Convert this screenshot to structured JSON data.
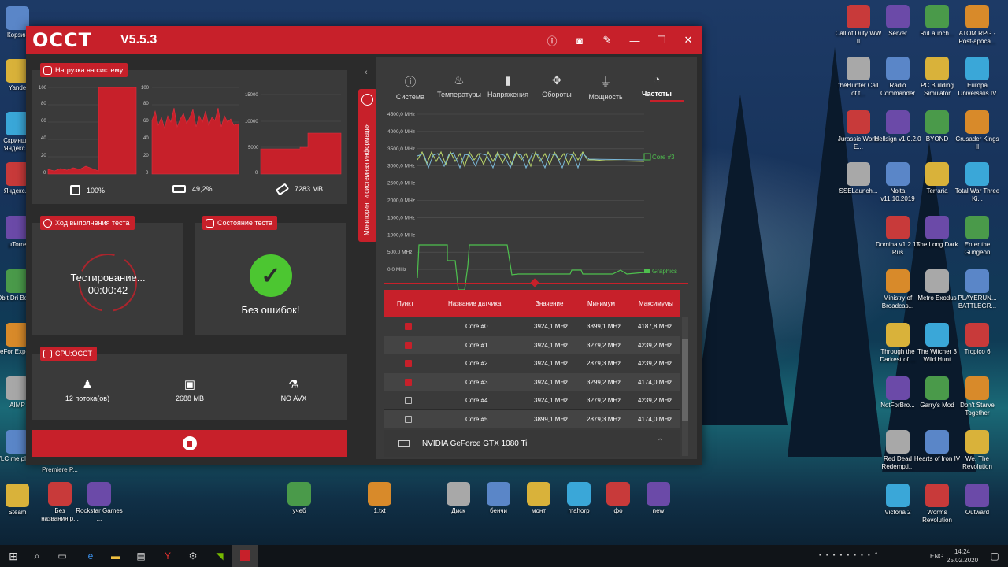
{
  "window": {
    "logo": "OCCT",
    "version": "V5.5.3",
    "buttons": [
      "info",
      "camera",
      "wrench",
      "minimize",
      "maximize",
      "close"
    ]
  },
  "load_panel": {
    "title": "Нагрузка на систему",
    "cpu": {
      "label": "100%",
      "ticks": [
        "100",
        "80",
        "60",
        "40",
        "20",
        "0"
      ]
    },
    "ram": {
      "label": "49,2%",
      "ticks": [
        "100",
        "80",
        "60",
        "40",
        "20",
        "0"
      ]
    },
    "mem": {
      "label": "7283 MB",
      "ticks": [
        "15000",
        "10000",
        "5000",
        "0"
      ]
    }
  },
  "progress_panel": {
    "title": "Ход выполнения теста",
    "status": "Тестирование...",
    "time": "00:00:42"
  },
  "state_panel": {
    "title": "Состояние теста",
    "result": "Без ошибок!"
  },
  "cpu_panel": {
    "title": "CPU:OCCT",
    "threads": "12 потока(ов)",
    "memory": "2688 MB",
    "avx": "NO AVX"
  },
  "side_tab": "Мониторинг и системная информация",
  "tabs": [
    {
      "label": "Система",
      "icon": "info-icon"
    },
    {
      "label": "Температуры",
      "icon": "thermometer-icon"
    },
    {
      "label": "Напряжения",
      "icon": "battery-icon"
    },
    {
      "label": "Обороты",
      "icon": "fan-icon"
    },
    {
      "label": "Мощность",
      "icon": "plug-icon"
    },
    {
      "label": "Частоты",
      "icon": "gauge-icon"
    }
  ],
  "freq_chart": {
    "ticks": [
      "4500,0 MHz",
      "4000,0 MHz",
      "3500,0 MHz",
      "3000,0 MHz",
      "2500,0 MHz",
      "2000,0 MHz",
      "1500,0 MHz",
      "1000,0 MHz",
      "500,0 MHz",
      "0,0 MHz"
    ],
    "legend_cpu": "Core #3",
    "legend_gpu": "Graphics"
  },
  "sensor_table": {
    "headers": [
      "Пункт",
      "Название датчика",
      "Значение",
      "Минимум",
      "Максимумы"
    ],
    "rows": [
      {
        "checked": true,
        "name": "Core #0",
        "value": "3924,1 MHz",
        "min": "3899,1 MHz",
        "max": "4187,8 MHz"
      },
      {
        "checked": true,
        "name": "Core #1",
        "value": "3924,1 MHz",
        "min": "3279,2 MHz",
        "max": "4239,2 MHz"
      },
      {
        "checked": true,
        "name": "Core #2",
        "value": "3924,1 MHz",
        "min": "2879,3 MHz",
        "max": "4239,2 MHz"
      },
      {
        "checked": true,
        "name": "Core #3",
        "value": "3924,1 MHz",
        "min": "3299,2 MHz",
        "max": "4174,0 MHz"
      },
      {
        "checked": false,
        "name": "Core #4",
        "value": "3924,1 MHz",
        "min": "3279,2 MHz",
        "max": "4239,2 MHz"
      },
      {
        "checked": false,
        "name": "Core #5",
        "value": "3899,1 MHz",
        "min": "2879,3 MHz",
        "max": "4174,0 MHz"
      }
    ],
    "gpu_group": "NVIDIA GeForce GTX 1080 Ti"
  },
  "desktop_left": [
    "Корзин",
    "Yande",
    "Скринш в Яндекс.Д",
    "Яндекс.Д",
    "µTorre",
    "IObit Dri Booste",
    "GeFor Experien",
    "AIMP",
    "VLC me player",
    "Steam"
  ],
  "desktop_bottom": [
    "Premiere P...",
    "Без названия.p...",
    "Rockstar Games ...",
    "учеб",
    "1.txt",
    "Диск",
    "бенчи",
    "монт",
    "mahorp",
    "фо",
    "new"
  ],
  "desktop_right": [
    "Call of Duty WW II",
    "Server",
    "RuLaunch...",
    "ATOM RPG - Post-apoca...",
    "theHunter Call of t...",
    "Radio Commander",
    "PC Building Simulator",
    "Europa Universalis IV",
    "Jurassic World E...",
    "Hellsign v1.0.2.0",
    "BYOND",
    "Crusader Kings II",
    "SSELaunch...",
    "Noita v11.10.2019",
    "Terraria",
    "Total War Three Ki...",
    "Domina v1.2.15 Rus",
    "The Long Dark",
    "Enter the Gungeon",
    "Ministry of Broadcas...",
    "Metro Exodus",
    "PLAYERUN... BATTLEGR...",
    "Through the Darkest of ...",
    "The Witcher 3 Wild Hunt",
    "Tropico 6",
    "NotForBro...",
    "Garry's Mod",
    "Don't Starve Together",
    "Red Dead Redempti...",
    "Hearts of Iron IV",
    "We. The Revolution",
    "Victoria 2",
    "Worms Revolution",
    "Outward"
  ],
  "taskbar": {
    "lang": "ENG",
    "time": "14:24",
    "date": "25.02.2020"
  }
}
